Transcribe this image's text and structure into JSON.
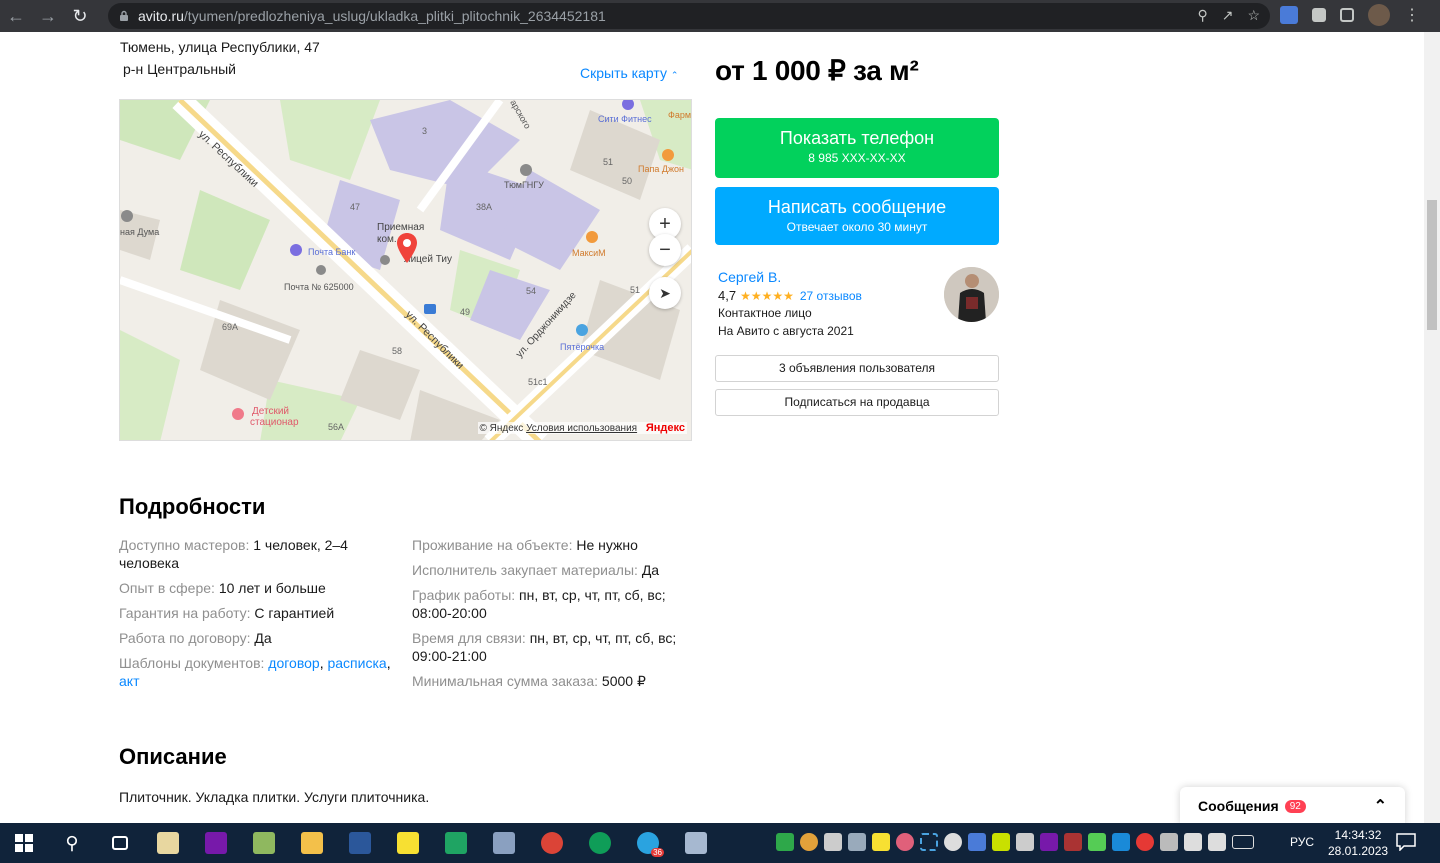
{
  "browser": {
    "url_host": "avito.ru",
    "url_path": "/tyumen/predlozheniya_uslug/ukladka_plitki_plitochnik_2634452181"
  },
  "listing": {
    "address": "Тюмень, улица Республики, 47",
    "district": "р-н Центральный",
    "hide_map": "Скрыть карту",
    "price": "от 1 000 ₽ за м²"
  },
  "map": {
    "labels": {
      "street1": "ул. Республики",
      "street2": "ул. Республики",
      "street3": "ул. Орджоникидзе",
      "fitness": "Сити Фитнес",
      "pharm": "Фарм",
      "papa": "Папа Джон",
      "tyumgngu": "ТюмГНГУ",
      "bldg38a": "38А",
      "bldg47": "47",
      "bldg3": "3",
      "bldg51": "51",
      "bldg50": "50",
      "reception1": "Приемная",
      "reception2": "ком...",
      "lyceum": "Лицей Тиу",
      "duma": "ная Дума",
      "pochtabank": "Почта Банк",
      "pochta": "Почта № 625000",
      "maxim": "МаксиМ",
      "bldg54": "54",
      "bldg49": "49",
      "bldg51b": "51",
      "bldg69a": "69А",
      "bldg58": "58",
      "pyaterochka": "Пятёрочка",
      "bldg51c1": "51с1",
      "hospital1": "Детский",
      "hospital2": "стационар",
      "bldg56a": "56А",
      "sarsk": "арского"
    },
    "zoom_in": "+",
    "zoom_out": "−",
    "copyright": "© Яндекс",
    "terms": "Условия использования",
    "brand": "Яндекс"
  },
  "buttons": {
    "phone_label": "Показать телефон",
    "phone_number": "8 985 XXX-XX-XX",
    "message_label": "Написать сообщение",
    "message_sub": "Отвечает около 30 минут",
    "listings": "3 объявления пользователя",
    "subscribe": "Подписаться на продавца"
  },
  "seller": {
    "name": "Сергей В.",
    "rating": "4,7",
    "stars": "★★★★★",
    "reviews": "27 отзывов",
    "role": "Контактное лицо",
    "since": "На Авито с августа 2021"
  },
  "details": {
    "heading": "Подробности",
    "left": [
      {
        "k": "Доступно мастеров:",
        "v": "1 человек, 2–4 человека"
      },
      {
        "k": "Опыт в сфере:",
        "v": "10 лет и больше"
      },
      {
        "k": "Гарантия на работу:",
        "v": "С гарантией"
      },
      {
        "k": "Работа по договору:",
        "v": "Да"
      }
    ],
    "templates_key": "Шаблоны документов:",
    "templates": [
      "договор",
      "расписка",
      "акт"
    ],
    "right": [
      {
        "k": "Проживание на объекте:",
        "v": "Не нужно"
      },
      {
        "k": "Исполнитель закупает материалы:",
        "v": "Да"
      },
      {
        "k": "График работы:",
        "v": "пн, вт, ср, чт, пт, сб, вс; 08:00-20:00"
      },
      {
        "k": "Время для связи:",
        "v": "пн, вт, ср, чт, пт, сб, вс; 09:00-21:00"
      },
      {
        "k": "Минимальная сумма заказа:",
        "v": "5000 ₽"
      }
    ]
  },
  "description": {
    "heading": "Описание",
    "text": "Плиточник. Укладка плитки. Услуги плиточника."
  },
  "messages": {
    "label": "Сообщения",
    "count": "92"
  },
  "taskbar": {
    "lang": "РУС",
    "time": "14:34:32",
    "date": "28.01.2023",
    "telegram_badge": "36"
  },
  "colors": {
    "green": "#02d15c",
    "blue": "#00aaff",
    "link": "#0a88ff"
  }
}
